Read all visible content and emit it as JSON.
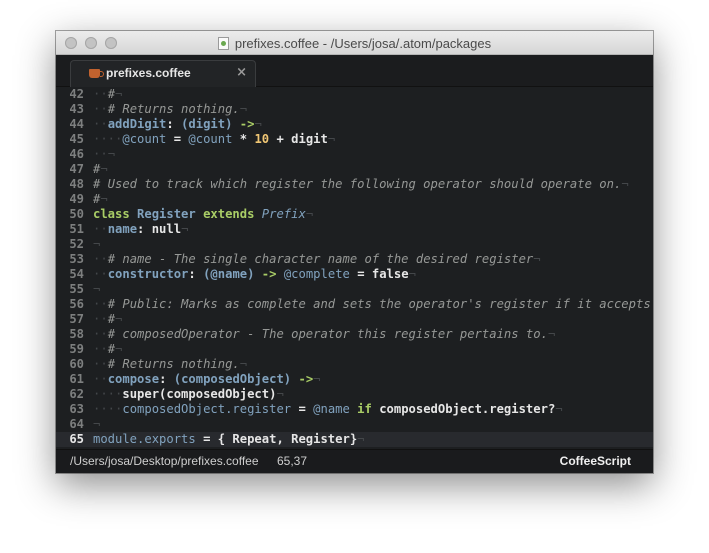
{
  "window": {
    "title": "prefixes.coffee - /Users/josa/.atom/packages"
  },
  "tab": {
    "label": "prefixes.coffee",
    "close_glyph": "×",
    "icon": "coffee-icon"
  },
  "editor": {
    "invisibles": {
      "eol": "¬",
      "indent": "·"
    },
    "current_line": 65,
    "lines": [
      {
        "num": "42",
        "tokens": [
          [
            "ind",
            "  "
          ],
          [
            "com",
            "#"
          ],
          [
            "eol",
            "¬"
          ]
        ]
      },
      {
        "num": "43",
        "tokens": [
          [
            "ind",
            "  "
          ],
          [
            "com",
            "# Returns nothing."
          ],
          [
            "eol",
            "¬"
          ]
        ]
      },
      {
        "num": "44",
        "tokens": [
          [
            "ind",
            "  "
          ],
          [
            "fn",
            "addDigit"
          ],
          [
            "txt",
            ": "
          ],
          [
            "fn",
            "(digit)"
          ],
          [
            "key",
            " ->"
          ],
          [
            "eol",
            "¬"
          ]
        ]
      },
      {
        "num": "45",
        "tokens": [
          [
            "ind",
            "    "
          ],
          [
            "ivar",
            "@count"
          ],
          [
            "txt",
            " = "
          ],
          [
            "ivar",
            "@count"
          ],
          [
            "txt",
            " * "
          ],
          [
            "num",
            "10"
          ],
          [
            "txt",
            " + digit"
          ],
          [
            "eol",
            "¬"
          ]
        ]
      },
      {
        "num": "46",
        "tokens": [
          [
            "ind",
            "  "
          ],
          [
            "eol",
            "¬"
          ]
        ]
      },
      {
        "num": "47",
        "tokens": [
          [
            "com",
            "#"
          ],
          [
            "eol",
            "¬"
          ]
        ]
      },
      {
        "num": "48",
        "tokens": [
          [
            "com",
            "# Used to track which register the following operator should operate on."
          ],
          [
            "eol",
            "¬"
          ]
        ]
      },
      {
        "num": "49",
        "tokens": [
          [
            "com",
            "#"
          ],
          [
            "eol",
            "¬"
          ]
        ]
      },
      {
        "num": "50",
        "tokens": [
          [
            "key",
            "class "
          ],
          [
            "cls",
            "Register"
          ],
          [
            "key",
            " extends "
          ],
          [
            "inh",
            "Prefix"
          ],
          [
            "eol",
            "¬"
          ]
        ]
      },
      {
        "num": "51",
        "tokens": [
          [
            "ind",
            "  "
          ],
          [
            "fn",
            "name"
          ],
          [
            "txt",
            ": null"
          ],
          [
            "eol",
            "¬"
          ]
        ]
      },
      {
        "num": "52",
        "tokens": [
          [
            "eol",
            "¬"
          ]
        ]
      },
      {
        "num": "53",
        "tokens": [
          [
            "ind",
            "  "
          ],
          [
            "com",
            "# name - The single character name of the desired register"
          ],
          [
            "eol",
            "¬"
          ]
        ]
      },
      {
        "num": "54",
        "tokens": [
          [
            "ind",
            "  "
          ],
          [
            "fn",
            "constructor"
          ],
          [
            "txt",
            ": "
          ],
          [
            "fn",
            "(@name)"
          ],
          [
            "key",
            " -> "
          ],
          [
            "ivar",
            "@complete"
          ],
          [
            "txt",
            " = false"
          ],
          [
            "eol",
            "¬"
          ]
        ]
      },
      {
        "num": "55",
        "tokens": [
          [
            "eol",
            "¬"
          ]
        ]
      },
      {
        "num": "56",
        "tokens": [
          [
            "ind",
            "  "
          ],
          [
            "com",
            "# Public: Marks as complete and sets the operator's register if it accepts it."
          ],
          [
            "eol",
            "¬"
          ]
        ]
      },
      {
        "num": "57",
        "tokens": [
          [
            "ind",
            "  "
          ],
          [
            "com",
            "#"
          ],
          [
            "eol",
            "¬"
          ]
        ]
      },
      {
        "num": "58",
        "tokens": [
          [
            "ind",
            "  "
          ],
          [
            "com",
            "# composedOperator - The operator this register pertains to."
          ],
          [
            "eol",
            "¬"
          ]
        ]
      },
      {
        "num": "59",
        "tokens": [
          [
            "ind",
            "  "
          ],
          [
            "com",
            "#"
          ],
          [
            "eol",
            "¬"
          ]
        ]
      },
      {
        "num": "60",
        "tokens": [
          [
            "ind",
            "  "
          ],
          [
            "com",
            "# Returns nothing."
          ],
          [
            "eol",
            "¬"
          ]
        ]
      },
      {
        "num": "61",
        "tokens": [
          [
            "ind",
            "  "
          ],
          [
            "fn",
            "compose"
          ],
          [
            "txt",
            ": "
          ],
          [
            "fn",
            "(composedObject)"
          ],
          [
            "key",
            " ->"
          ],
          [
            "eol",
            "¬"
          ]
        ]
      },
      {
        "num": "62",
        "tokens": [
          [
            "ind",
            "    "
          ],
          [
            "txt",
            "super(composedObject)"
          ],
          [
            "eol",
            "¬"
          ]
        ]
      },
      {
        "num": "63",
        "tokens": [
          [
            "ind",
            "    "
          ],
          [
            "ivar",
            "composedObject.register"
          ],
          [
            "txt",
            " = "
          ],
          [
            "ivar",
            "@name"
          ],
          [
            "key",
            " if "
          ],
          [
            "txt",
            "composedObject.register?"
          ],
          [
            "eol",
            "¬"
          ]
        ]
      },
      {
        "num": "64",
        "tokens": [
          [
            "eol",
            "¬"
          ]
        ]
      },
      {
        "num": "65",
        "tokens": [
          [
            "ivar",
            "module.exports"
          ],
          [
            "txt",
            " = { Repeat, Register}"
          ],
          [
            "eol",
            "¬"
          ]
        ]
      }
    ]
  },
  "status": {
    "path": "/Users/josa/Desktop/prefixes.coffee",
    "cursor": "65,37",
    "grammar": "CoffeeScript"
  },
  "colors": {
    "background": "#1d1f21",
    "comment": "#969896",
    "keyword": "#a9cd66",
    "function": "#81a2be",
    "number": "#f0c674",
    "text": "#e6e6e6"
  }
}
